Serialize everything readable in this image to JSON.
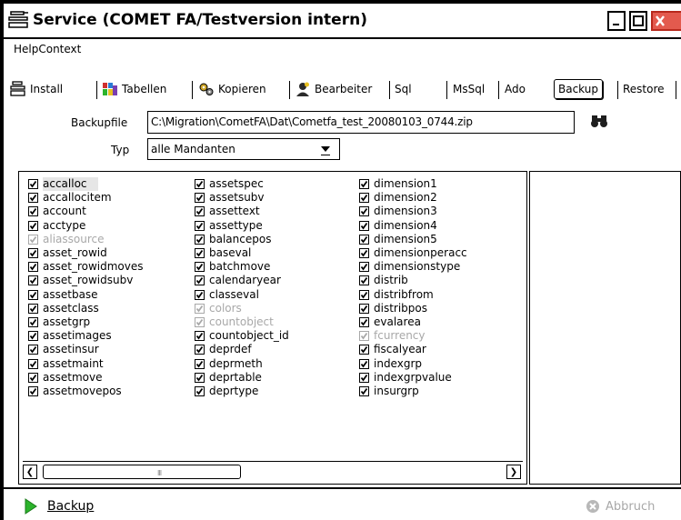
{
  "window": {
    "title": "Service (COMET FA/Testversion intern)",
    "app_icon": "service-icon",
    "buttons": {
      "minimize": "minimize-icon",
      "maximize": "maximize-icon",
      "close": "close-icon"
    }
  },
  "menu": {
    "items": [
      {
        "label": "HelpContext"
      }
    ]
  },
  "toolbar": {
    "items": [
      {
        "label": "Install",
        "icon": "install-icon"
      },
      {
        "label": "Tabellen",
        "icon": "tables-icon"
      },
      {
        "label": "Kopieren",
        "icon": "gears-icon"
      },
      {
        "label": "Bearbeiter",
        "icon": "editor-icon"
      },
      {
        "label": "Sql"
      },
      {
        "label": "MsSql"
      },
      {
        "label": "Ado"
      },
      {
        "label": "Backup"
      },
      {
        "label": "Restore"
      }
    ],
    "active": "Backup"
  },
  "form": {
    "backupfile_label": "Backupfile",
    "backupfile_value": "C:\\Migration\\CometFA\\Dat\\Cometfa_test_20080103_0744.zip",
    "browse_icon": "binoculars-icon",
    "typ_label": "Typ",
    "typ_value": "alle Mandanten"
  },
  "tables": {
    "columns": [
      [
        {
          "name": "accalloc",
          "checked": true,
          "enabled": true,
          "selected": true
        },
        {
          "name": "accallocitem",
          "checked": true,
          "enabled": true
        },
        {
          "name": "account",
          "checked": true,
          "enabled": true
        },
        {
          "name": "acctype",
          "checked": true,
          "enabled": true
        },
        {
          "name": "aliassource",
          "checked": true,
          "enabled": false
        },
        {
          "name": "asset_rowid",
          "checked": true,
          "enabled": true
        },
        {
          "name": "asset_rowidmoves",
          "checked": true,
          "enabled": true
        },
        {
          "name": "asset_rowidsubv",
          "checked": true,
          "enabled": true
        },
        {
          "name": "assetbase",
          "checked": true,
          "enabled": true
        },
        {
          "name": "assetclass",
          "checked": true,
          "enabled": true
        },
        {
          "name": "assetgrp",
          "checked": true,
          "enabled": true
        },
        {
          "name": "assetimages",
          "checked": true,
          "enabled": true
        },
        {
          "name": "assetinsur",
          "checked": true,
          "enabled": true
        },
        {
          "name": "assetmaint",
          "checked": true,
          "enabled": true
        },
        {
          "name": "assetmove",
          "checked": true,
          "enabled": true
        },
        {
          "name": "assetmovepos",
          "checked": true,
          "enabled": true
        }
      ],
      [
        {
          "name": "assetspec",
          "checked": true,
          "enabled": true
        },
        {
          "name": "assetsubv",
          "checked": true,
          "enabled": true
        },
        {
          "name": "assettext",
          "checked": true,
          "enabled": true
        },
        {
          "name": "assettype",
          "checked": true,
          "enabled": true
        },
        {
          "name": "balancepos",
          "checked": true,
          "enabled": true
        },
        {
          "name": "baseval",
          "checked": true,
          "enabled": true
        },
        {
          "name": "batchmove",
          "checked": true,
          "enabled": true
        },
        {
          "name": "calendaryear",
          "checked": true,
          "enabled": true
        },
        {
          "name": "classeval",
          "checked": true,
          "enabled": true
        },
        {
          "name": "colors",
          "checked": true,
          "enabled": false
        },
        {
          "name": "countobject",
          "checked": true,
          "enabled": false
        },
        {
          "name": "countobject_id",
          "checked": true,
          "enabled": true
        },
        {
          "name": "deprdef",
          "checked": true,
          "enabled": true
        },
        {
          "name": "deprmeth",
          "checked": true,
          "enabled": true
        },
        {
          "name": "deprtable",
          "checked": true,
          "enabled": true
        },
        {
          "name": "deprtype",
          "checked": true,
          "enabled": true
        }
      ],
      [
        {
          "name": "dimension1",
          "checked": true,
          "enabled": true
        },
        {
          "name": "dimension2",
          "checked": true,
          "enabled": true
        },
        {
          "name": "dimension3",
          "checked": true,
          "enabled": true
        },
        {
          "name": "dimension4",
          "checked": true,
          "enabled": true
        },
        {
          "name": "dimension5",
          "checked": true,
          "enabled": true
        },
        {
          "name": "dimensionperacc",
          "checked": true,
          "enabled": true
        },
        {
          "name": "dimensionstype",
          "checked": true,
          "enabled": true
        },
        {
          "name": "distrib",
          "checked": true,
          "enabled": true
        },
        {
          "name": "distribfrom",
          "checked": true,
          "enabled": true
        },
        {
          "name": "distribpos",
          "checked": true,
          "enabled": true
        },
        {
          "name": "evalarea",
          "checked": true,
          "enabled": true
        },
        {
          "name": "fcurrency",
          "checked": true,
          "enabled": false
        },
        {
          "name": "fiscalyear",
          "checked": true,
          "enabled": true
        },
        {
          "name": "indexgrp",
          "checked": true,
          "enabled": true
        },
        {
          "name": "indexgrpvalue",
          "checked": true,
          "enabled": true
        },
        {
          "name": "insurgrp",
          "checked": true,
          "enabled": true
        }
      ]
    ],
    "scroll_grip": "III"
  },
  "footer": {
    "backup_label": "Backup",
    "backup_icon": "play-icon",
    "abbruch_label": "Abbruch",
    "abbruch_icon": "cancel-icon"
  },
  "colors": {
    "close_button": "#e35a4e",
    "play_green": "#2cb42c",
    "disabled": "#a8a8a8"
  }
}
